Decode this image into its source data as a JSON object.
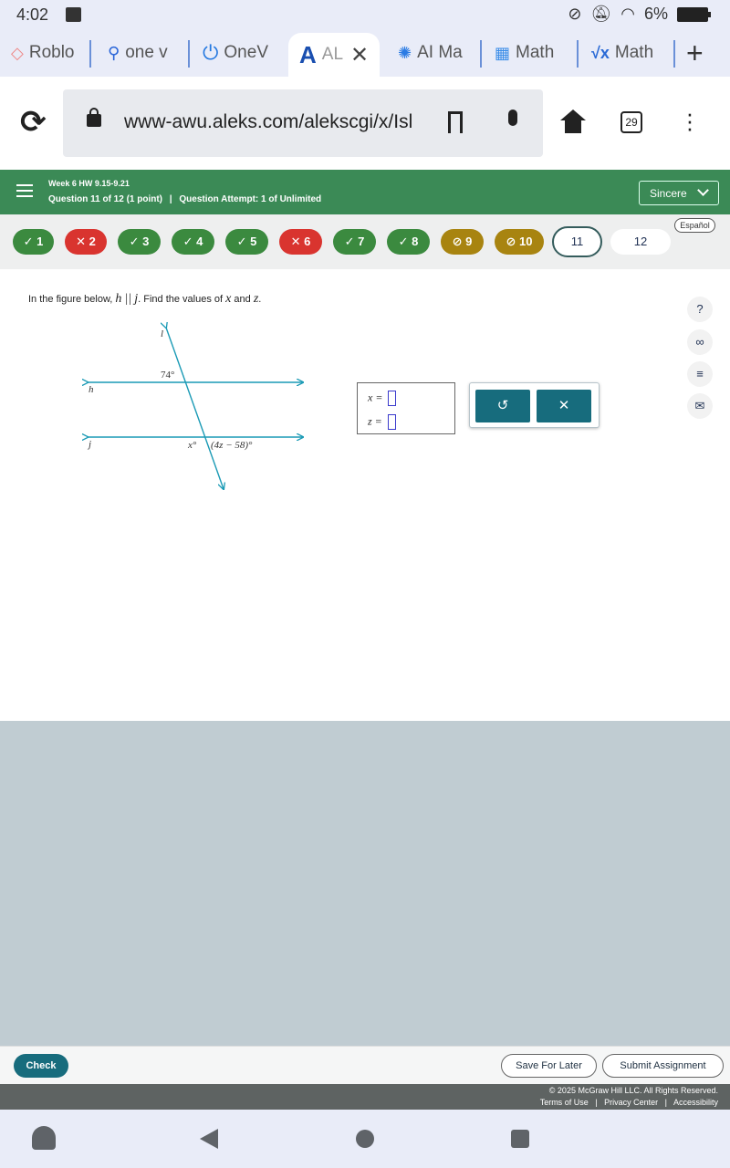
{
  "status": {
    "time": "4:02",
    "battery": "6%"
  },
  "tabs": [
    {
      "label": "Roblo",
      "icon": "roblox-icon"
    },
    {
      "label": "one v",
      "icon": "search-icon"
    },
    {
      "label": "OneV",
      "icon": "power-icon"
    },
    {
      "label": "AL",
      "icon": "aleks-icon",
      "active": true
    },
    {
      "label": "AI Ma",
      "icon": "ai-icon"
    },
    {
      "label": "Math",
      "icon": "cube-icon"
    },
    {
      "label": "Math",
      "icon": "sqrt-icon"
    }
  ],
  "browser": {
    "url": "www-awu.aleks.com/alekscgi/x/Isl",
    "tab_count": "29"
  },
  "header": {
    "assignment": "Week 6 HW 9.15-9.21",
    "question_info": "Question 11 of 12 (1 point)",
    "attempt_info": "Question Attempt: 1 of Unlimited",
    "user": "Sincere"
  },
  "qnav": {
    "language": "Español",
    "items": [
      {
        "label": "1",
        "status": "correct"
      },
      {
        "label": "2",
        "status": "incorrect"
      },
      {
        "label": "3",
        "status": "correct"
      },
      {
        "label": "4",
        "status": "correct"
      },
      {
        "label": "5",
        "status": "correct"
      },
      {
        "label": "6",
        "status": "incorrect"
      },
      {
        "label": "7",
        "status": "correct"
      },
      {
        "label": "8",
        "status": "correct"
      },
      {
        "label": "9",
        "status": "partial"
      },
      {
        "label": "10",
        "status": "partial"
      },
      {
        "label": "11",
        "status": "current"
      },
      {
        "label": "12",
        "status": "unanswered"
      }
    ]
  },
  "question": {
    "prompt_pre": "In the figure below,",
    "var_h": "h",
    "parallel": "||",
    "var_j": "j",
    "prompt_post": ". Find the values of",
    "var_x": "x",
    "and": "and",
    "var_z": "z",
    "period": "."
  },
  "figure": {
    "line_l": "l",
    "line_h": "h",
    "line_j": "j",
    "angle_top": "74°",
    "angle_x": "x°",
    "angle_z": "(4z − 58)°"
  },
  "answers": {
    "x_label": "x =",
    "z_label": "z =",
    "x_value": "",
    "z_value": ""
  },
  "tools": {
    "undo_icon": "undo-icon",
    "clear_icon": "close-icon"
  },
  "footer": {
    "check": "Check",
    "save": "Save For Later",
    "submit": "Submit Assignment",
    "copyright": "© 2025 McGraw Hill LLC. All Rights Reserved.",
    "terms": "Terms of Use",
    "privacy": "Privacy Center",
    "accessibility": "Accessibility"
  }
}
